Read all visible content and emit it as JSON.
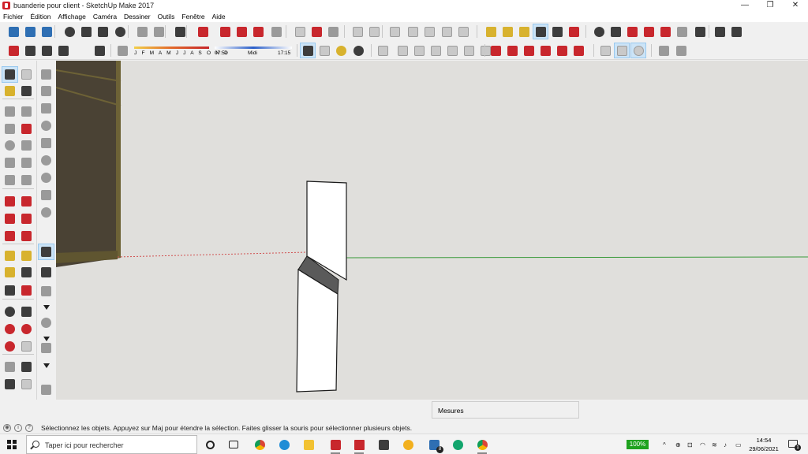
{
  "window": {
    "title": "buanderie pour client - SketchUp Make 2017",
    "minimize": "—",
    "restore": "❐",
    "close": "✕"
  },
  "menu": [
    "Fichier",
    "Édition",
    "Affichage",
    "Caméra",
    "Dessiner",
    "Outils",
    "Fenêtre",
    "Aide"
  ],
  "shadow": {
    "months": "J F M A M J J A S O N D",
    "time_start": "07:52",
    "time_mid": "Midi",
    "time_end": "17:15"
  },
  "measures": {
    "label": "Mesures"
  },
  "status": {
    "hint": "Sélectionnez les objets. Appuyez sur Maj pour étendre la sélection. Faites glisser la souris pour sélectionner plusieurs objets."
  },
  "taskbar": {
    "search_placeholder": "Taper ici pour rechercher",
    "mail_badge": "8",
    "battery": "100%",
    "time": "14:54",
    "date": "29/06/2021",
    "notif_count": "1"
  },
  "colors": {
    "viewport_bg": "#e0dfdc",
    "axis_green": "#3a9a3a",
    "axis_red_dotted": "#d05050",
    "cabinet_dark": "#4a4234",
    "cabinet_trim": "#6d6236",
    "panel_face": "#ffffff",
    "panel_shade": "#555555",
    "selected_tool": "#cce4f7",
    "battery_green": "#1fa21f"
  },
  "toolbar_icons": {
    "row1": [
      "new-model-icon",
      "open-icon",
      "save-icon",
      "cut-icon",
      "copy-icon",
      "paste-icon",
      "erase-icon",
      "undo-icon",
      "redo-icon",
      "print-icon",
      "model-info-icon",
      "3d-warehouse-icon",
      "share-model-icon",
      "extension-warehouse-icon",
      "layout-icon",
      "components-icon",
      "get-models-icon",
      "export-icon",
      "iso-view-icon",
      "top-view-icon",
      "front-view-icon",
      "right-view-icon",
      "back-view-icon",
      "left-view-icon",
      "xray-icon",
      "back-edges-icon",
      "wireframe-icon",
      "hidden-line-icon",
      "shaded-icon",
      "textures-icon",
      "monochrome-icon",
      "tape-measure-icon",
      "dimension-icon",
      "protractor-icon",
      "text-icon",
      "axes-icon",
      "3d-text-icon",
      "orbit-icon",
      "pan-icon",
      "zoom-icon",
      "zoom-window-icon",
      "zoom-extents-icon",
      "position-camera-icon",
      "walk-icon",
      "look-around-icon",
      "footprints-icon"
    ],
    "row2": [
      "warehouse-box-icon",
      "book-icon",
      "house-icon",
      "home-front-icon",
      "garage-icon",
      "shadows-toggle-icon",
      "select-icon",
      "component-icon",
      "paint-bucket-icon",
      "eraser-icon",
      "group-icon",
      "solid-1-icon",
      "solid-2-icon",
      "solid-3-icon",
      "solid-4-icon",
      "solid-5-icon",
      "solid-6-icon",
      "move-icon",
      "push-pull-icon",
      "rotate-icon",
      "follow-me-icon",
      "scale-icon",
      "offset-icon",
      "section-plane-icon",
      "display-sections-icon",
      "section-cuts-icon",
      "sandbox-icon",
      "sandbox-tools-icon"
    ]
  }
}
